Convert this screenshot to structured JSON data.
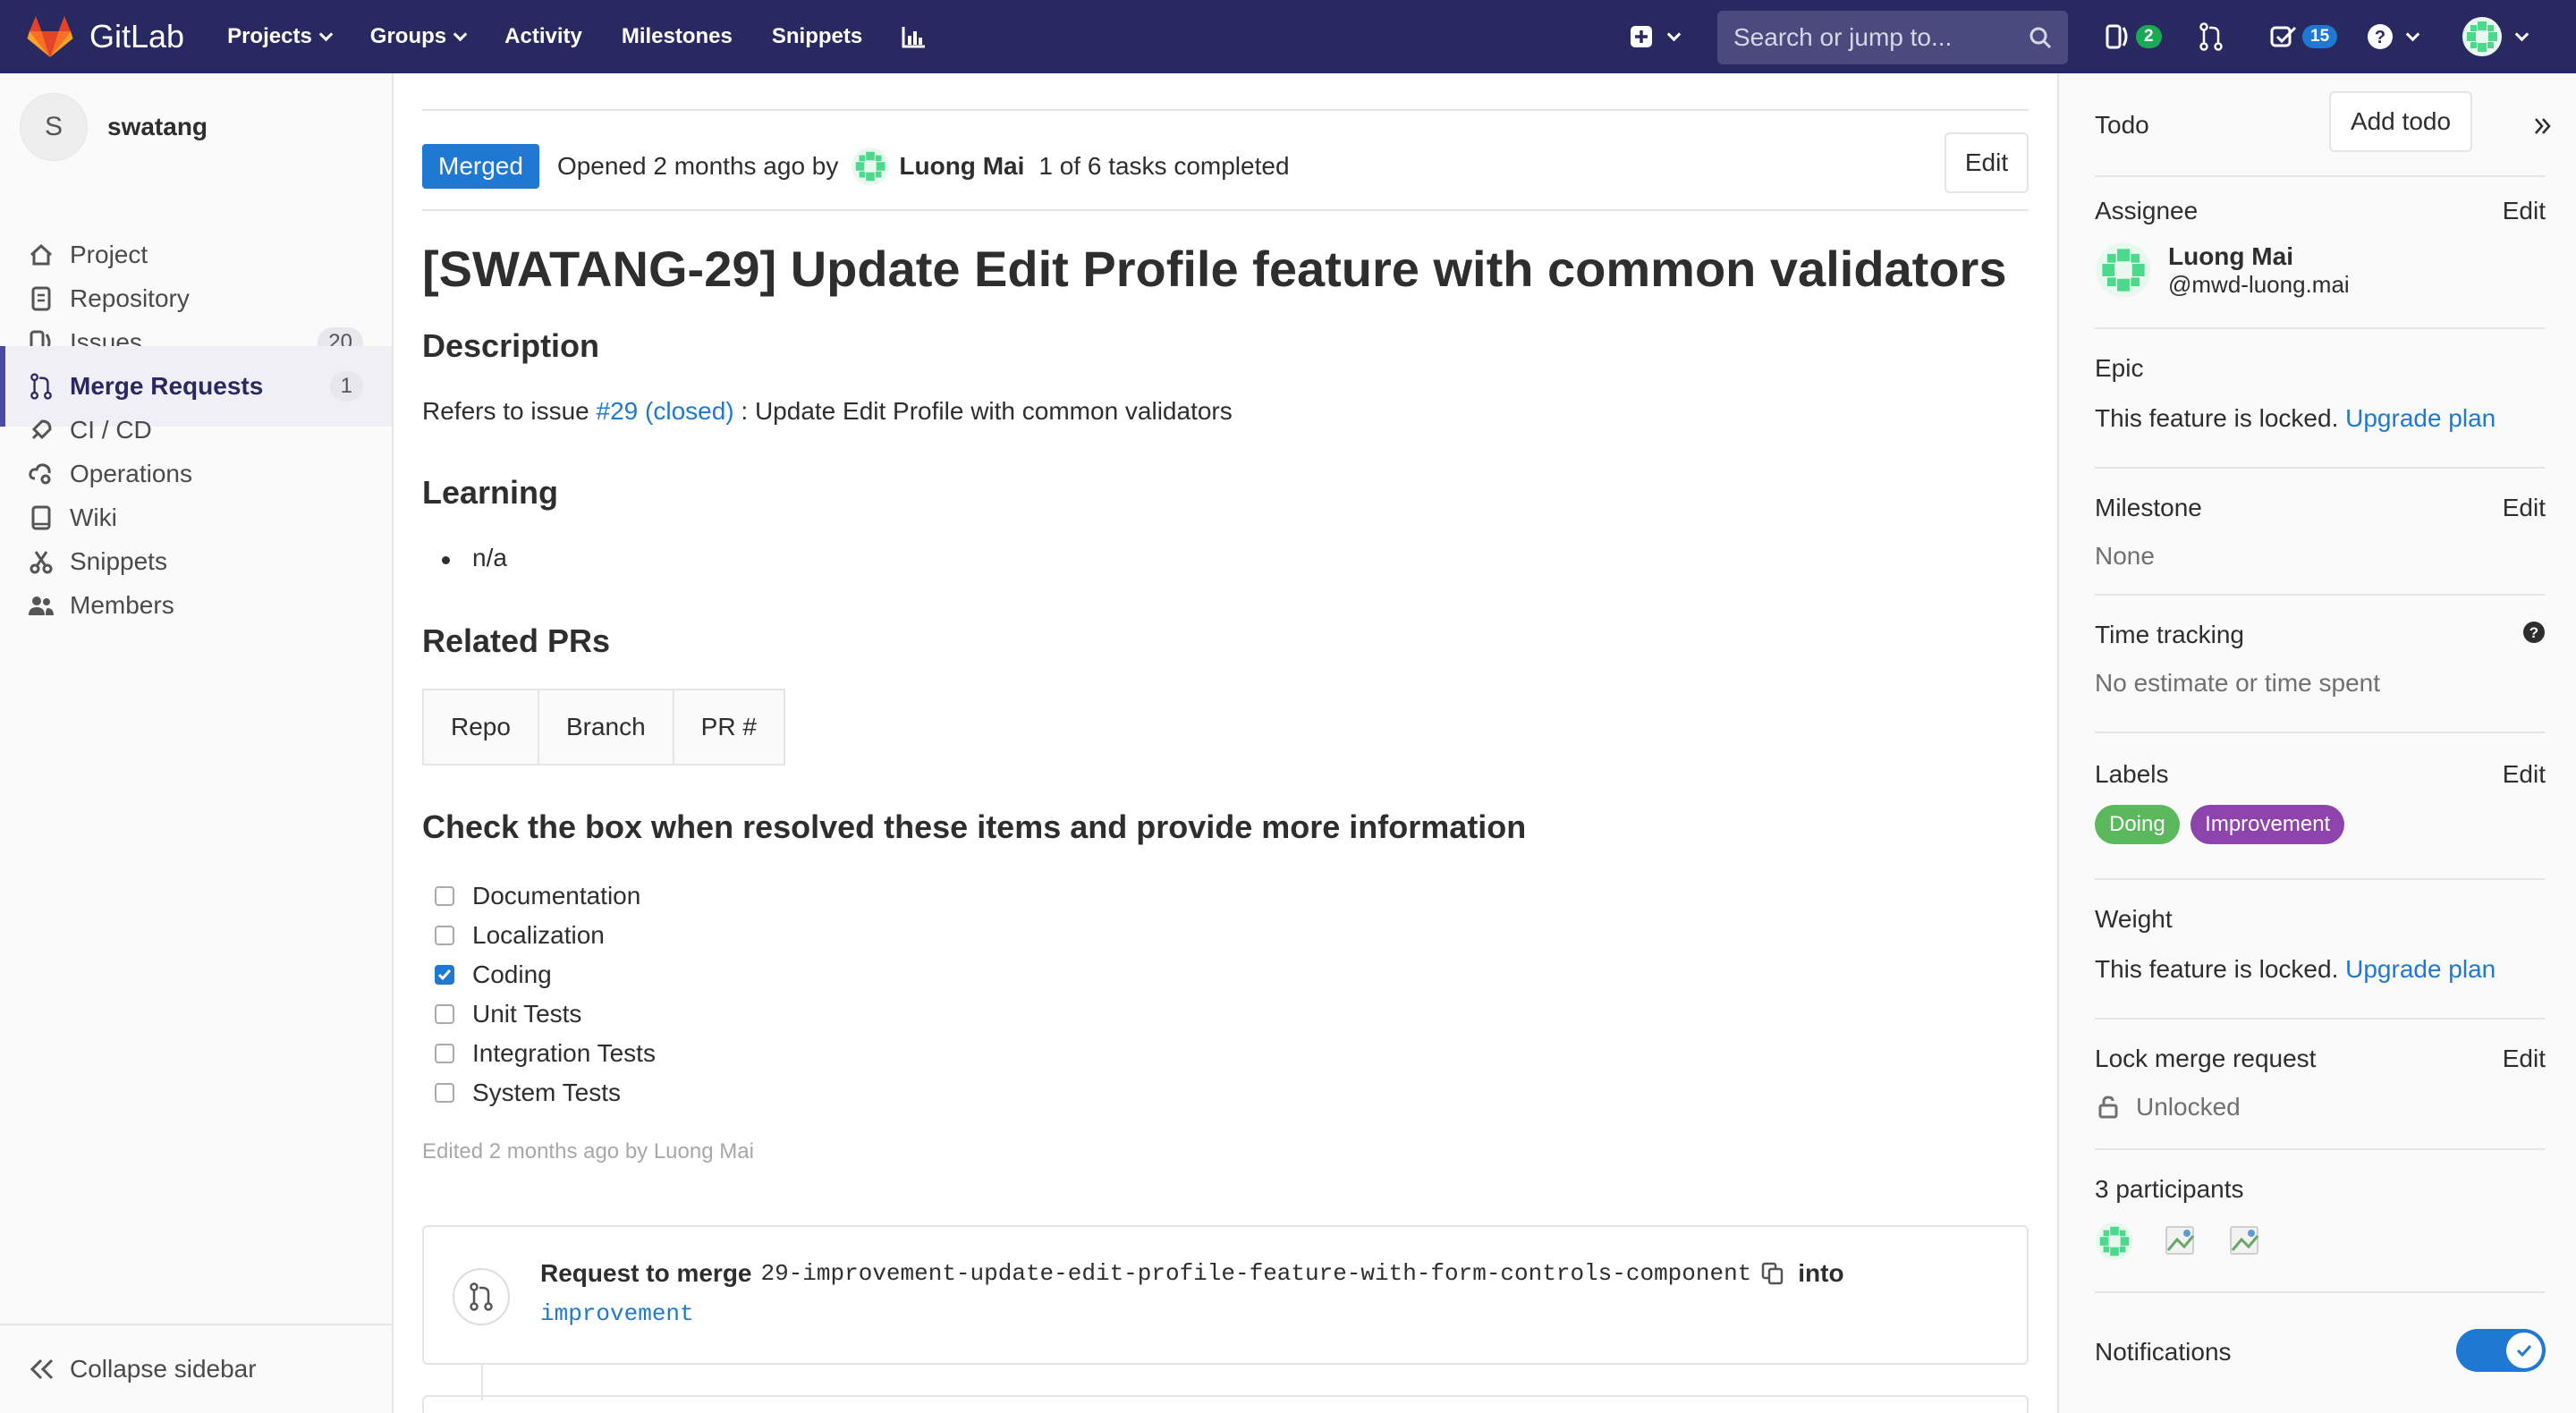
{
  "navbar": {
    "brand": "GitLab",
    "links": [
      "Projects",
      "Groups",
      "Activity",
      "Milestones",
      "Snippets"
    ],
    "search_placeholder": "Search or jump to...",
    "issues_count": "2",
    "todos_count": "15"
  },
  "sidebar": {
    "project_initial": "S",
    "project_name": "swatang",
    "items": [
      {
        "label": "Project"
      },
      {
        "label": "Repository"
      },
      {
        "label": "Issues",
        "badge": "20"
      },
      {
        "label": "Merge Requests",
        "badge": "1"
      },
      {
        "label": "CI / CD"
      },
      {
        "label": "Operations"
      },
      {
        "label": "Wiki"
      },
      {
        "label": "Snippets"
      },
      {
        "label": "Members"
      }
    ],
    "collapse_label": "Collapse sidebar"
  },
  "main": {
    "status_badge": "Merged",
    "opened_text": "Opened 2 months ago by",
    "author": "Luong Mai",
    "tasks_text": "1 of 6 tasks completed",
    "edit_label": "Edit",
    "title": "[SWATANG-29] Update Edit Profile feature with common validators",
    "description_heading": "Description",
    "refers_prefix": "Refers to issue",
    "refers_link": "#29 (closed)",
    "refers_suffix": ": Update Edit Profile with common validators",
    "learning_heading": "Learning",
    "learning_items": [
      "n/a"
    ],
    "related_heading": "Related PRs",
    "related_columns": [
      "Repo",
      "Branch",
      "PR #"
    ],
    "checklist_heading": "Check the box when resolved these items and provide more information",
    "checklist": [
      {
        "label": "Documentation",
        "checked": false
      },
      {
        "label": "Localization",
        "checked": false
      },
      {
        "label": "Coding",
        "checked": true
      },
      {
        "label": "Unit Tests",
        "checked": false
      },
      {
        "label": "Integration Tests",
        "checked": false
      },
      {
        "label": "System Tests",
        "checked": false
      }
    ],
    "edited_text": "Edited 2 months ago by Luong Mai",
    "merge_request_prefix": "Request to merge",
    "source_branch": "29-improvement-update-edit-profile-feature-with-form-controls-component",
    "into_label": "into",
    "target_branch": "improvement"
  },
  "right_sidebar": {
    "todo_label": "Todo",
    "add_todo_label": "Add todo",
    "assignee_label": "Assignee",
    "assignee_name": "Luong Mai",
    "assignee_username": "@mwd-luong.mai",
    "epic_label": "Epic",
    "locked_text": "This feature is locked.",
    "upgrade_link": "Upgrade plan",
    "milestone_label": "Milestone",
    "milestone_value": "None",
    "time_tracking_label": "Time tracking",
    "time_tracking_value": "No estimate or time spent",
    "labels_label": "Labels",
    "labels": [
      {
        "name": "Doing",
        "color": "#5cb85c"
      },
      {
        "name": "Improvement",
        "color": "#8e44ad"
      }
    ],
    "weight_label": "Weight",
    "lock_label": "Lock merge request",
    "lock_value": "Unlocked",
    "participants_label": "3 participants",
    "notifications_label": "Notifications",
    "notifications_on": true,
    "edit_label": "Edit"
  },
  "colors": {
    "navbar": "#292961",
    "accent": "#1f78d1",
    "merged": "#1f78d1"
  }
}
